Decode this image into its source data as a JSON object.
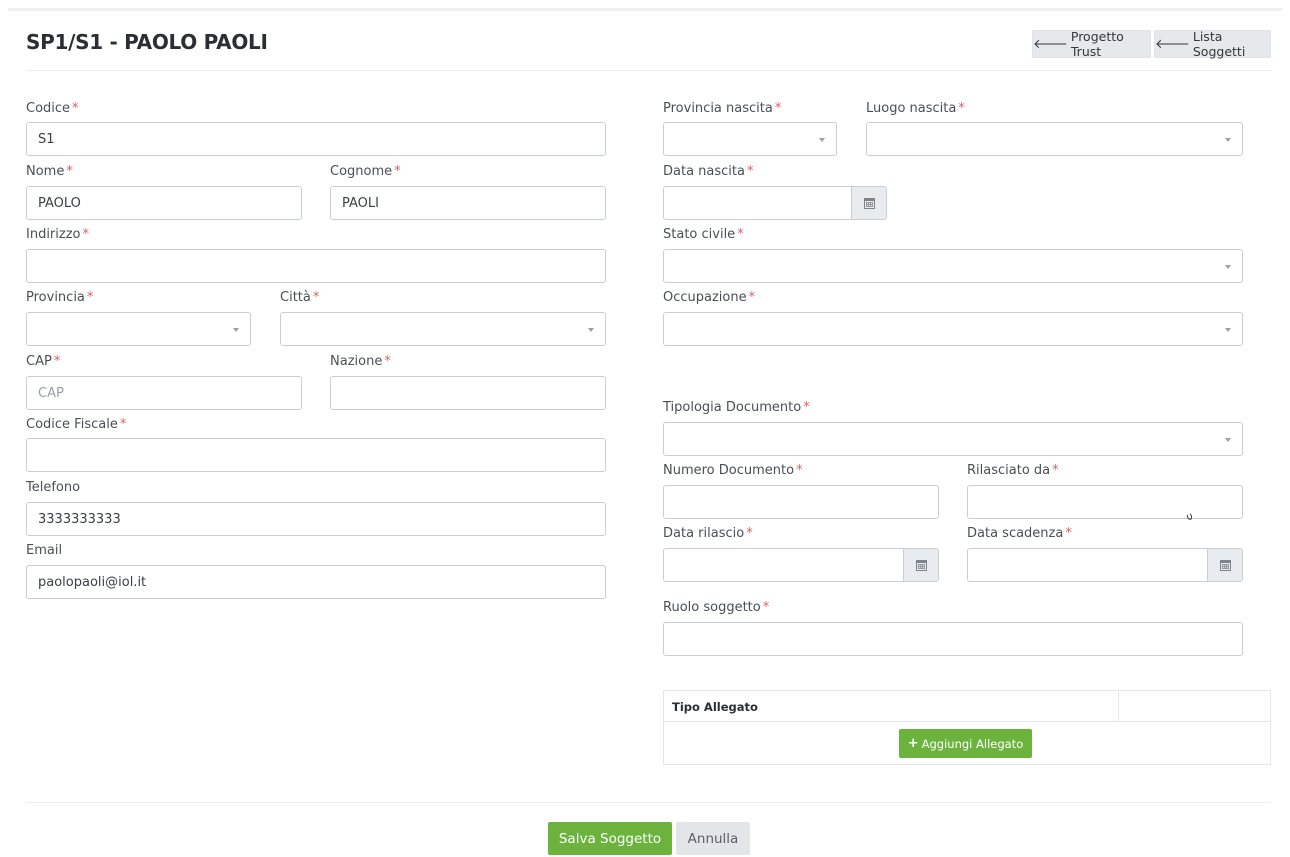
{
  "header": {
    "title": "SP1/S1 - PAOLO PAOLI",
    "btn_progetto": "Progetto Trust",
    "btn_lista": "Lista Soggetti",
    "arrow_icon": "arrow-left-icon"
  },
  "form": {
    "codice": {
      "label": "Codice",
      "value": "S1"
    },
    "nome": {
      "label": "Nome",
      "value": "PAOLO"
    },
    "cognome": {
      "label": "Cognome",
      "value": "PAOLI"
    },
    "indirizzo": {
      "label": "Indirizzo",
      "value": ""
    },
    "provincia": {
      "label": "Provincia",
      "value": ""
    },
    "citta": {
      "label": "Città",
      "value": ""
    },
    "cap": {
      "label": "CAP",
      "placeholder": "CAP"
    },
    "nazione": {
      "label": "Nazione",
      "value": ""
    },
    "codice_fiscale": {
      "label": "Codice Fiscale",
      "value": ""
    },
    "telefono": {
      "label": "Telefono",
      "value": "3333333333"
    },
    "email": {
      "label": "Email",
      "value": "paolopaoli@iol.it"
    },
    "provincia_nascita": {
      "label": "Provincia nascita",
      "value": ""
    },
    "luogo_nascita": {
      "label": "Luogo nascita",
      "value": ""
    },
    "data_nascita": {
      "label": "Data nascita",
      "value": ""
    },
    "stato_civile": {
      "label": "Stato civile",
      "value": ""
    },
    "occupazione": {
      "label": "Occupazione",
      "value": ""
    },
    "tipologia_documento": {
      "label": "Tipologia Documento",
      "value": ""
    },
    "numero_documento": {
      "label": "Numero Documento",
      "value": ""
    },
    "rilasciato_da": {
      "label": "Rilasciato da",
      "value": ""
    },
    "data_rilascio": {
      "label": "Data rilascio",
      "value": ""
    },
    "data_scadenza": {
      "label": "Data scadenza",
      "value": ""
    },
    "ruolo_soggetto": {
      "label": "Ruolo soggetto",
      "value": ""
    },
    "required_mark": "*"
  },
  "allegati": {
    "column_tipo": "Tipo Allegato",
    "add_button": "Aggiungi Allegato",
    "add_icon": "+"
  },
  "footer": {
    "save": "Salva Soggetto",
    "cancel": "Annulla"
  },
  "colors": {
    "accent_green": "#6cb33e",
    "required_red": "#e15d5d"
  }
}
